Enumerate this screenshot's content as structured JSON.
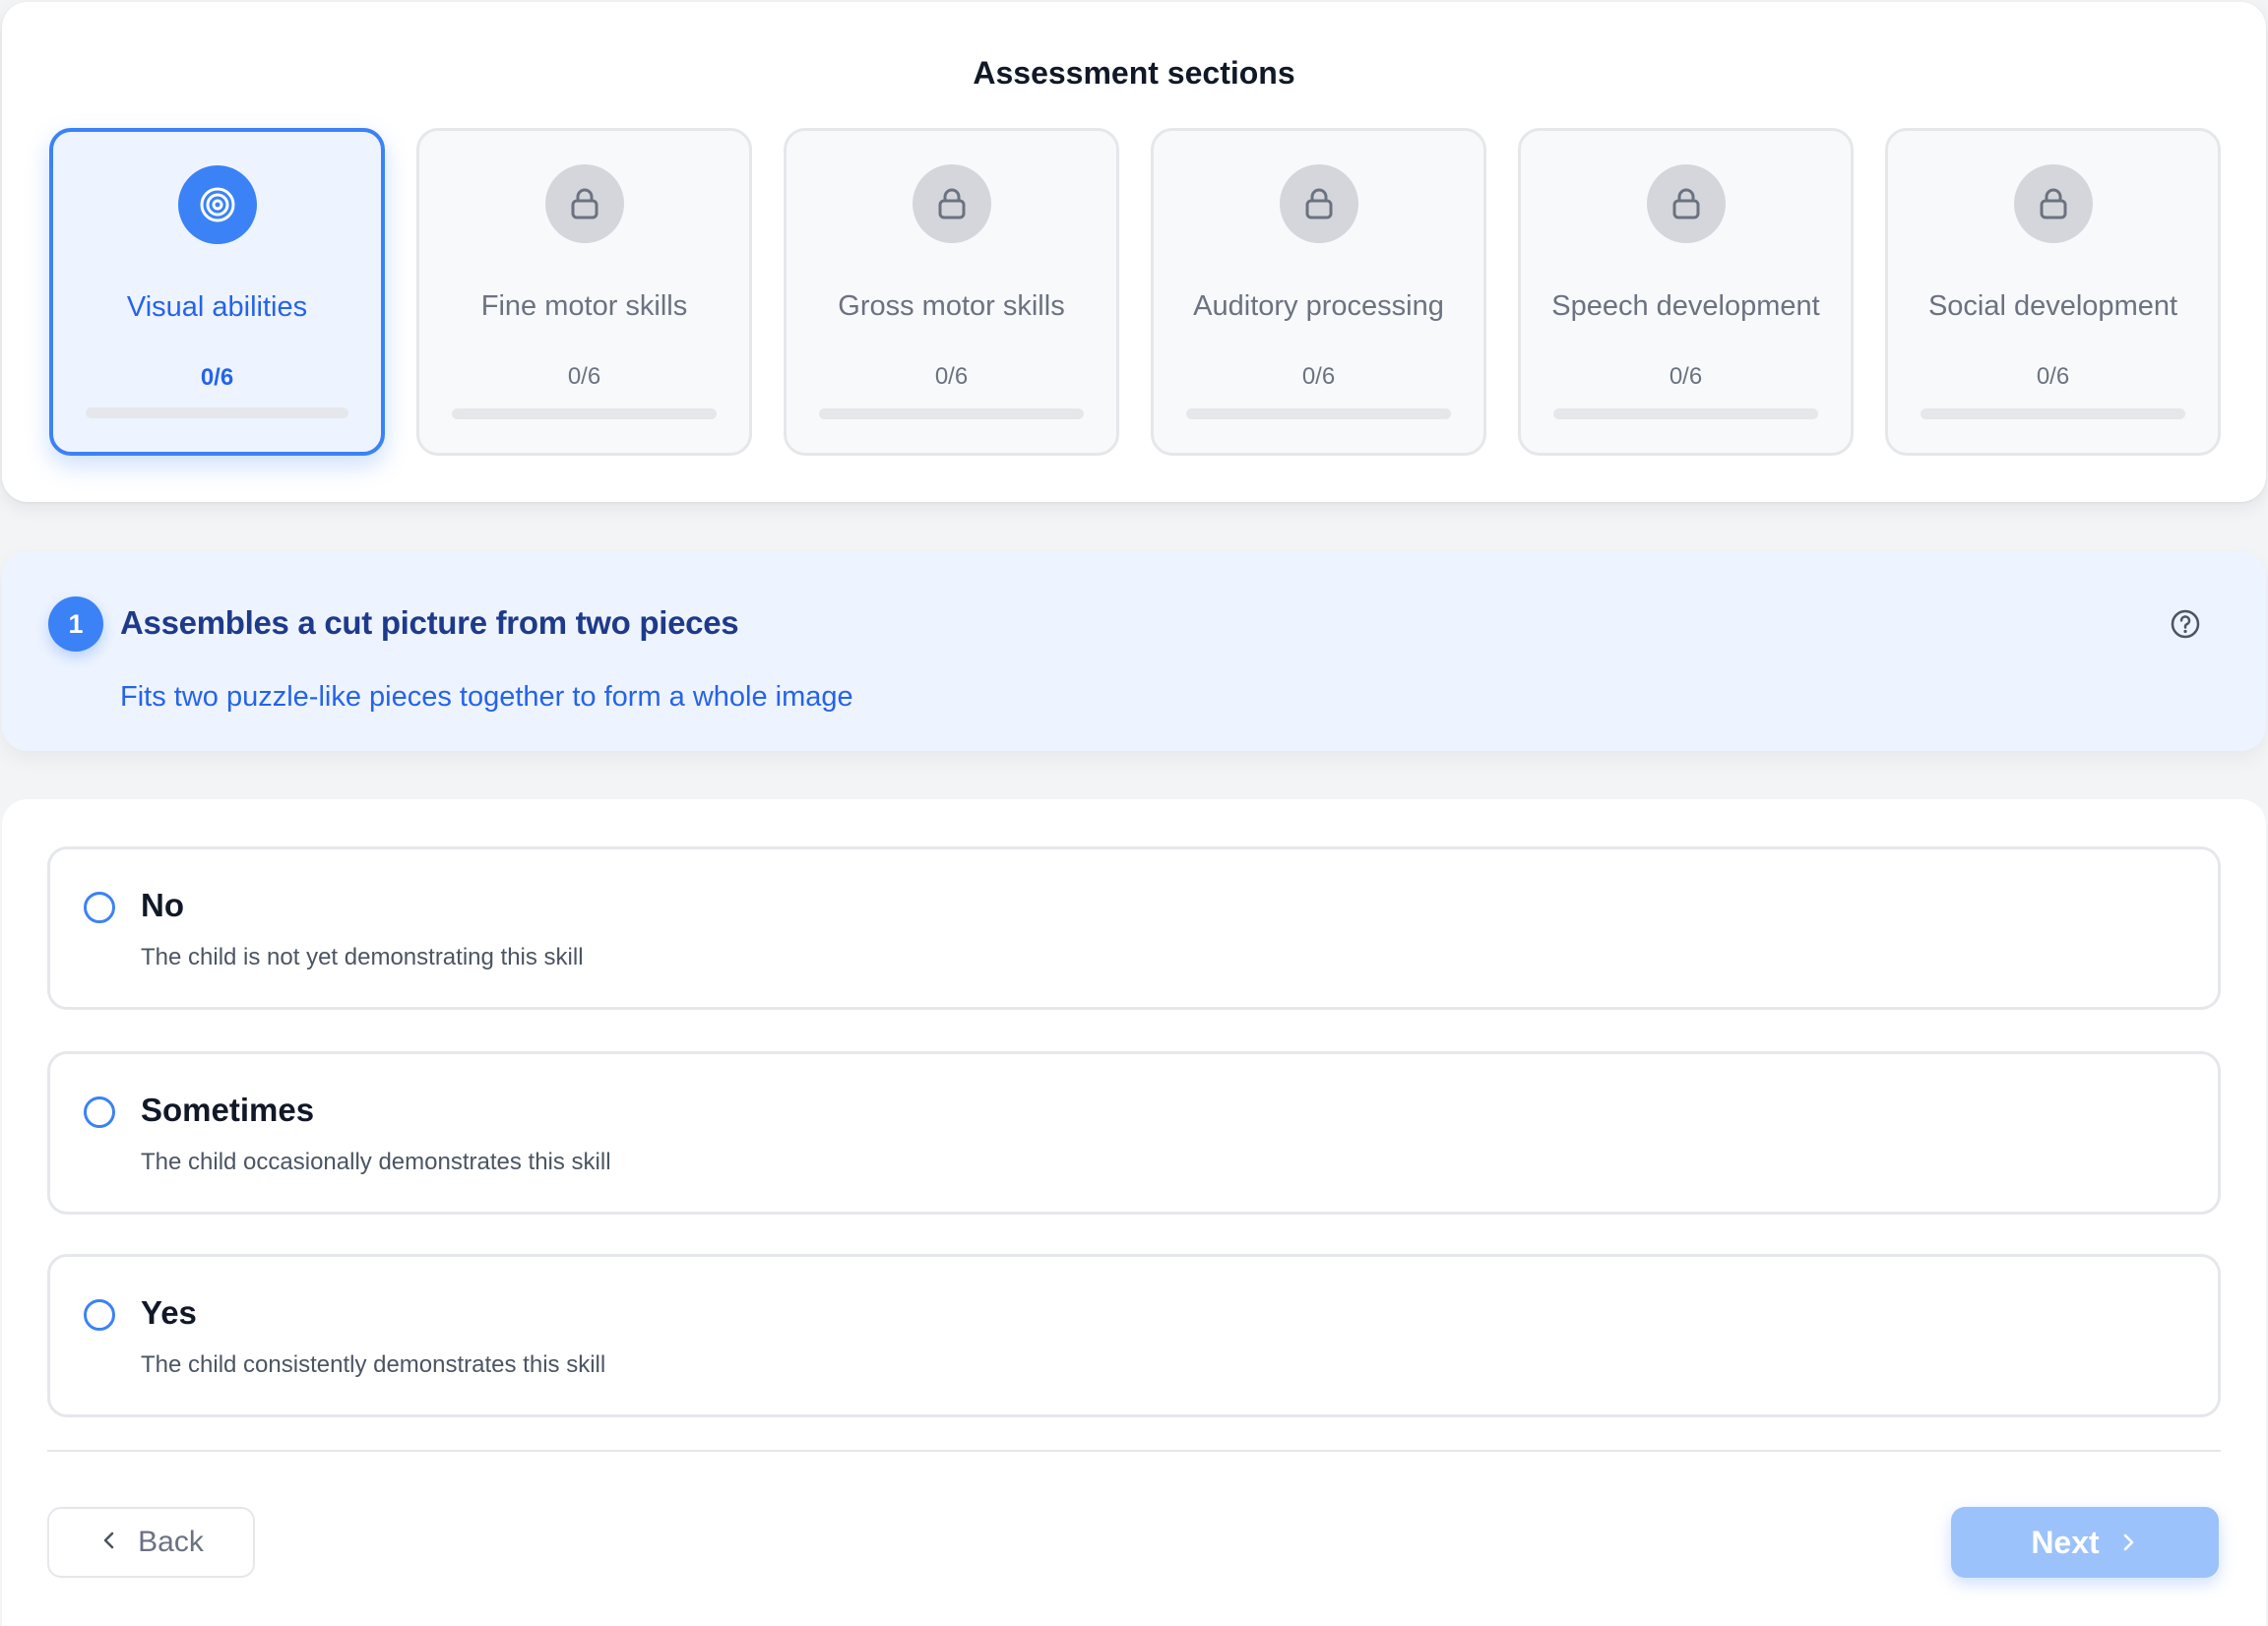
{
  "sections": {
    "title": "Assessment sections",
    "items": [
      {
        "label": "Visual abilities",
        "count": "0/6",
        "progress": 0,
        "state": "active",
        "icon": "target-icon"
      },
      {
        "label": "Fine motor skills",
        "count": "0/6",
        "progress": 0,
        "state": "locked",
        "icon": "lock-icon"
      },
      {
        "label": "Gross motor skills",
        "count": "0/6",
        "progress": 0,
        "state": "locked",
        "icon": "lock-icon"
      },
      {
        "label": "Auditory processing",
        "count": "0/6",
        "progress": 0,
        "state": "locked",
        "icon": "lock-icon"
      },
      {
        "label": "Speech development",
        "count": "0/6",
        "progress": 0,
        "state": "locked",
        "icon": "lock-icon"
      },
      {
        "label": "Social development",
        "count": "0/6",
        "progress": 0,
        "state": "locked",
        "icon": "lock-icon"
      }
    ]
  },
  "question": {
    "number": "1",
    "title": "Assembles a cut picture from two pieces",
    "description": "Fits two puzzle-like pieces together to form a whole image",
    "help_icon": "help-circle-icon"
  },
  "options": [
    {
      "label": "No",
      "description": "The child is not yet demonstrating this skill",
      "selected": false
    },
    {
      "label": "Sometimes",
      "description": "The child occasionally demonstrates this skill",
      "selected": false
    },
    {
      "label": "Yes",
      "description": "The child consistently demonstrates this skill",
      "selected": false
    }
  ],
  "navigation": {
    "back_label": "Back",
    "next_label": "Next",
    "back_icon": "chevron-left-icon",
    "next_icon": "chevron-right-icon"
  },
  "colors": {
    "accent": "#3b82f6",
    "accent_dark": "#1e3a8a",
    "locked": "#d4d6db",
    "next_disabled": "#9cc2fb"
  }
}
